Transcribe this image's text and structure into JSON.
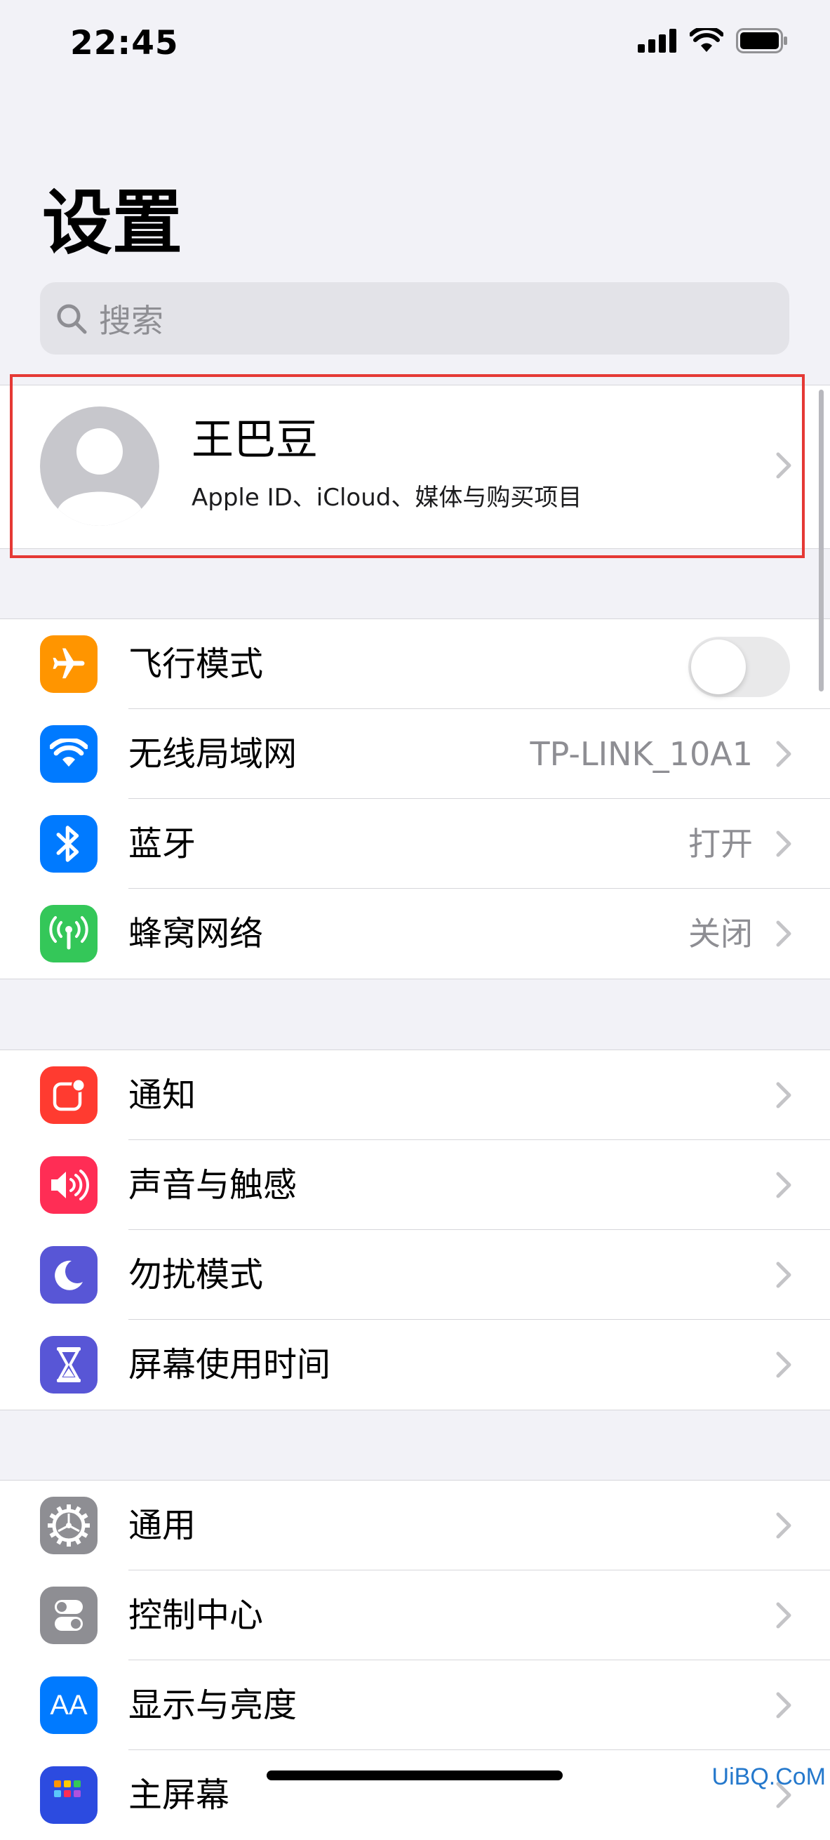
{
  "status_bar": {
    "time": "22:45"
  },
  "title": "设置",
  "search": {
    "placeholder": "搜索"
  },
  "profile": {
    "name": "王巴豆",
    "subtitle": "Apple ID、iCloud、媒体与购买项目"
  },
  "groups": [
    {
      "items": [
        {
          "label": "飞行模式",
          "icon": "airplane-icon",
          "color": "#ff9500",
          "toggle": false
        },
        {
          "label": "无线局域网",
          "icon": "wifi-icon",
          "color": "#007aff",
          "value": "TP-LINK_10A1"
        },
        {
          "label": "蓝牙",
          "icon": "bluetooth-icon",
          "color": "#007aff",
          "value": "打开"
        },
        {
          "label": "蜂窝网络",
          "icon": "cellular-icon",
          "color": "#34c759",
          "value": "关闭"
        }
      ]
    },
    {
      "items": [
        {
          "label": "通知",
          "icon": "notifications-icon",
          "color": "#ff3b30"
        },
        {
          "label": "声音与触感",
          "icon": "sound-icon",
          "color": "#ff2d55"
        },
        {
          "label": "勿扰模式",
          "icon": "moon-icon",
          "color": "#5856d6"
        },
        {
          "label": "屏幕使用时间",
          "icon": "hourglass-icon",
          "color": "#5856d6"
        }
      ]
    },
    {
      "items": [
        {
          "label": "通用",
          "icon": "gear-icon",
          "color": "#8e8e93"
        },
        {
          "label": "控制中心",
          "icon": "control-center-icon",
          "color": "#8e8e93"
        },
        {
          "label": "显示与亮度",
          "icon": "display-icon",
          "color": "#007aff",
          "icon_text": "AA"
        },
        {
          "label": "主屏幕",
          "icon": "home-screen-icon",
          "color": "#2c4be0"
        }
      ]
    }
  ],
  "watermark": "UiBQ.CoM"
}
